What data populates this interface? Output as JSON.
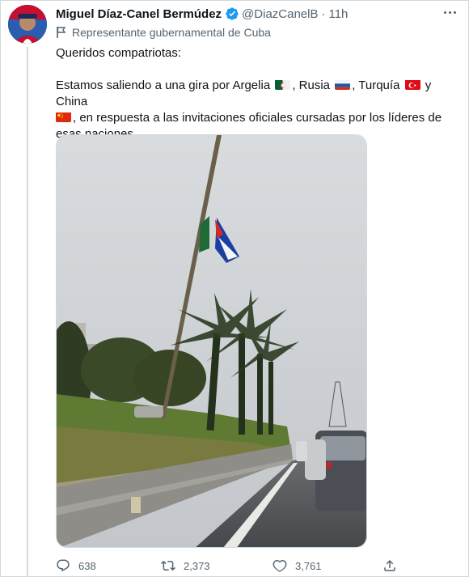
{
  "tweet": {
    "author_name": "Miguel Díaz-Canel Bermúdez",
    "handle": "@DiazCanelB",
    "separator": "·",
    "time": "11h",
    "gov_label": "Representante gubernamental de Cuba",
    "line1": "Queridos compatriotas:",
    "line2_a": "Estamos saliendo a una gira por Argelia",
    "line2_b": ", Rusia",
    "line2_c": ", Turquía",
    "line2_d": "y China",
    "line3": ", en respuesta a las invitaciones oficiales cursadas por los líderes de esas naciones."
  },
  "stats": {
    "replies": "638",
    "retweets": "2,373",
    "likes": "3,761"
  },
  "icons": {
    "verified": "verified-badge-icon",
    "gov_flag": "flag-icon",
    "reply": "reply-icon",
    "retweet": "retweet-icon",
    "like": "heart-icon",
    "share": "share-icon",
    "more": "more-icon"
  },
  "colors": {
    "text": "#0f1419",
    "muted": "#536471",
    "verified": "#1d9bf0",
    "border": "#cfd9de"
  }
}
